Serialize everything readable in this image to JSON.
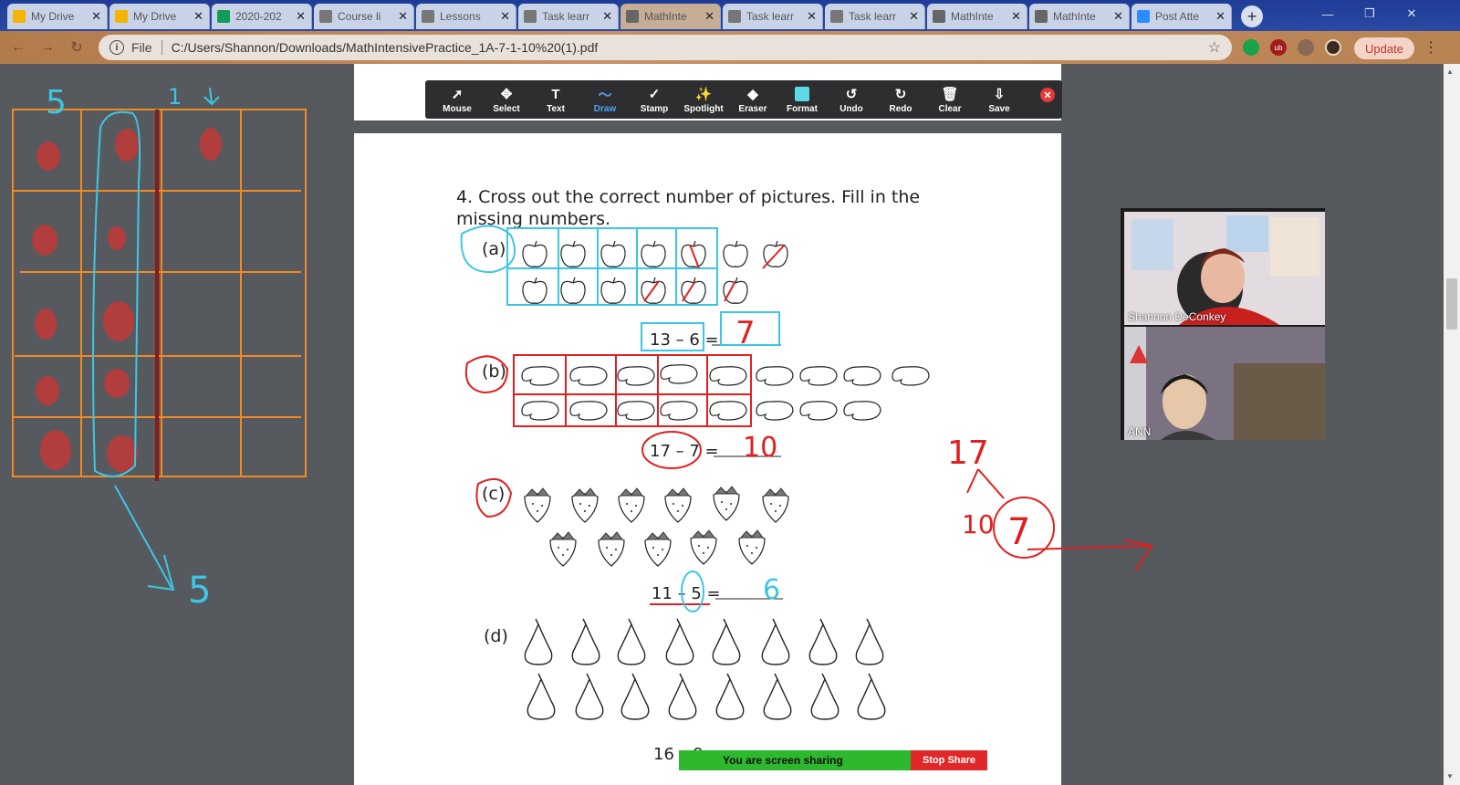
{
  "browser": {
    "tabs": [
      {
        "label": "My Drive",
        "icon": "google-drive-icon",
        "color": "#f4b400"
      },
      {
        "label": "My Drive",
        "icon": "google-drive-icon",
        "color": "#f4b400"
      },
      {
        "label": "2020-202",
        "icon": "sheets-icon",
        "color": "#0f9d58"
      },
      {
        "label": "Course li",
        "icon": "doc-icon",
        "color": "#777777"
      },
      {
        "label": "Lessons",
        "icon": "doc-icon",
        "color": "#777777"
      },
      {
        "label": "Task learr",
        "icon": "doc-icon",
        "color": "#777777"
      },
      {
        "label": "MathInte",
        "icon": "globe-icon",
        "color": "#666666"
      },
      {
        "label": "Task learr",
        "icon": "doc-icon",
        "color": "#777777"
      },
      {
        "label": "Task learr",
        "icon": "doc-icon",
        "color": "#777777"
      },
      {
        "label": "MathInte",
        "icon": "globe-icon",
        "color": "#666666"
      },
      {
        "label": "MathInte",
        "icon": "globe-icon",
        "color": "#666666"
      },
      {
        "label": "Post Atte",
        "icon": "zoom-icon",
        "color": "#2d8cff"
      }
    ],
    "active_tab_index": 6,
    "address": {
      "scheme": "File",
      "url": "C:/Users/Shannon/Downloads/MathIntensivePractice_1A-7-1-10%20(1).pdf"
    },
    "update_label": "Update"
  },
  "annotation_toolbar": {
    "tools": [
      {
        "label": "Mouse",
        "icon": "cursor-icon"
      },
      {
        "label": "Select",
        "icon": "move-icon"
      },
      {
        "label": "Text",
        "icon": "text-icon"
      },
      {
        "label": "Draw",
        "icon": "draw-icon",
        "active": true
      },
      {
        "label": "Stamp",
        "icon": "check-stamp-icon"
      },
      {
        "label": "Spotlight",
        "icon": "spotlight-icon"
      },
      {
        "label": "Eraser",
        "icon": "eraser-icon"
      },
      {
        "label": "Format",
        "icon": "format-color-icon"
      },
      {
        "label": "Undo",
        "icon": "undo-icon"
      },
      {
        "label": "Redo",
        "icon": "redo-icon"
      },
      {
        "label": "Clear",
        "icon": "trash-icon"
      },
      {
        "label": "Save",
        "icon": "save-icon"
      }
    ],
    "format_color": "#5dd8e6"
  },
  "worksheet": {
    "question": "4.  Cross out the correct number of pictures. Fill in the missing numbers.",
    "parts": [
      {
        "label": "(a)",
        "equation": "13 – 6 =",
        "answer": "7"
      },
      {
        "label": "(b)",
        "equation": "17 – 7 =",
        "answer": "10"
      },
      {
        "label": "(c)",
        "equation": "11 – 5 =",
        "answer": "6"
      },
      {
        "label": "(d)",
        "equation": "16 – 9",
        "answer": ""
      }
    ]
  },
  "whiteboard_annotations": {
    "left_numbers": [
      "5",
      "1",
      "5"
    ],
    "right_numbers": [
      "17",
      "10",
      "7"
    ]
  },
  "video": {
    "participants": [
      {
        "name": "Shannon DeConkey"
      },
      {
        "name": "ANN"
      }
    ]
  },
  "share_bar": {
    "status": "You are screen sharing",
    "stop_label": "Stop Share"
  }
}
